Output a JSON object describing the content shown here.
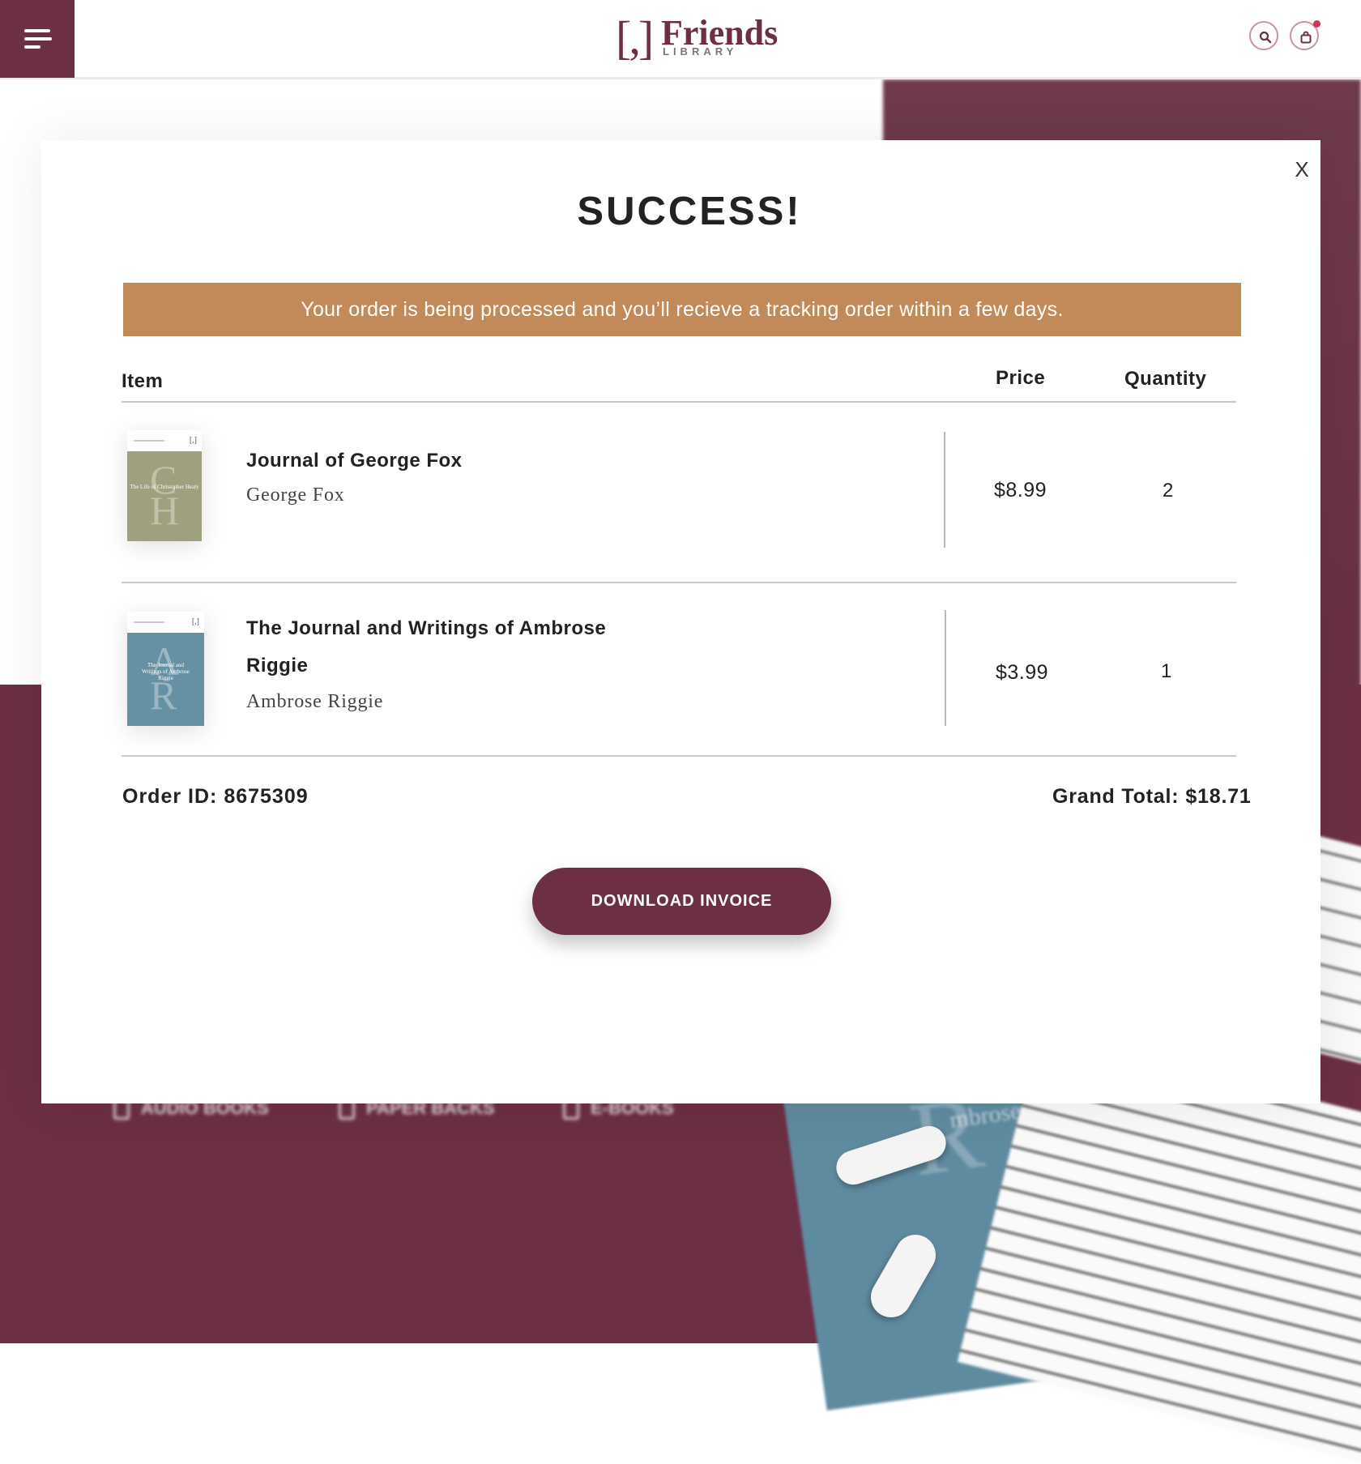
{
  "header": {
    "logo": {
      "bracket": "[,]",
      "name": "Friends",
      "sub": "LIBRARY"
    },
    "icons": {
      "menu": "menu-icon",
      "search": "search-icon",
      "cart": "cart-icon"
    }
  },
  "background": {
    "nav": [
      {
        "label": "AUDIO BOOKS",
        "icon": "headphones-icon"
      },
      {
        "label": "PAPER BACKS",
        "icon": "book-icon"
      },
      {
        "label": "E-BOOKS",
        "icon": "tablet-icon"
      }
    ],
    "photo_book_text": "mbrose"
  },
  "modal": {
    "close_label": "X",
    "title": "SUCCESS!",
    "message": "Your order is being processed and you’ll recieve a tracking order within a few days.",
    "columns": {
      "item": "Item",
      "price": "Price",
      "quantity": "Quantity"
    },
    "items": [
      {
        "title": "Journal of George Fox",
        "author": "George Fox",
        "price": "$8.99",
        "quantity": "2",
        "cover": {
          "letters": [
            "C",
            "H"
          ],
          "text": "The Life of Christopher Healy",
          "color": "#9fa07d"
        }
      },
      {
        "title": "The Journal and Writings of Ambrose Riggie",
        "author": "Ambrose Riggie",
        "price": "$3.99",
        "quantity": "1",
        "cover": {
          "letters": [
            "A",
            "R"
          ],
          "text": "The Journal and Writings of Ambrose Riggie",
          "color": "#6691a5"
        }
      }
    ],
    "order_id_label": "Order ID:",
    "order_id": "8675309",
    "grand_total_label": "Grand Total:",
    "grand_total": "$18.71",
    "download_label": "DOWNLOAD INVOICE"
  },
  "colors": {
    "brand": "#6c2f43",
    "banner": "#c28a58",
    "text": "#222222"
  }
}
